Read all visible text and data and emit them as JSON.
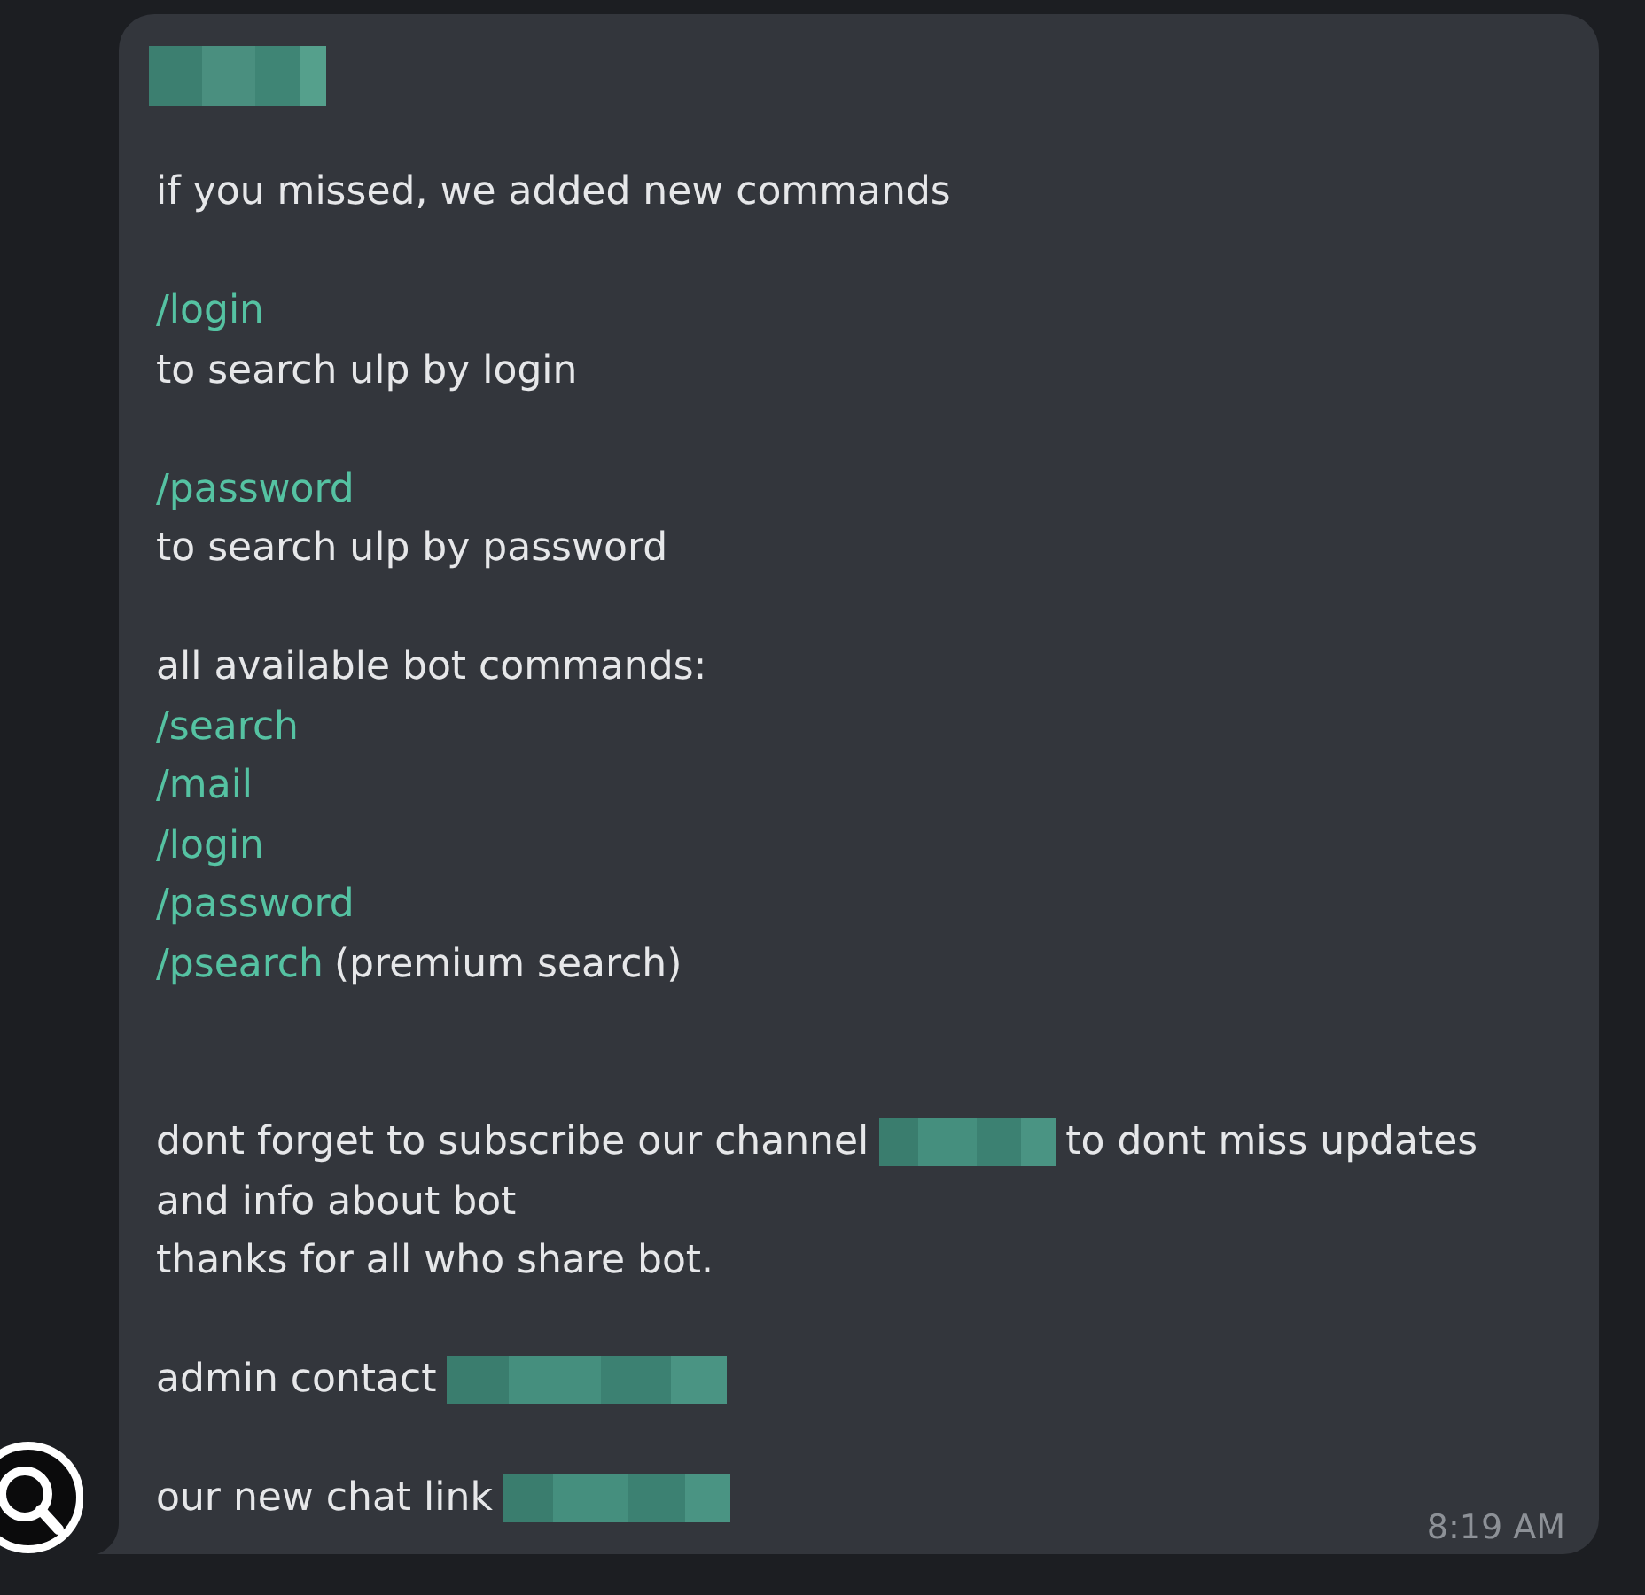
{
  "message": {
    "sender": {
      "kind": "redacted"
    },
    "lines": [
      {
        "kind": "line",
        "segments": [
          {
            "kind": "text",
            "text": "if you missed, we added new commands"
          }
        ]
      },
      {
        "kind": "blank"
      },
      {
        "kind": "line",
        "segments": [
          {
            "kind": "command",
            "text": "/login"
          }
        ]
      },
      {
        "kind": "line",
        "segments": [
          {
            "kind": "text",
            "text": "to search ulp by login"
          }
        ]
      },
      {
        "kind": "blank"
      },
      {
        "kind": "line",
        "segments": [
          {
            "kind": "command",
            "text": "/password"
          }
        ]
      },
      {
        "kind": "line",
        "segments": [
          {
            "kind": "text",
            "text": "to search ulp by password"
          }
        ]
      },
      {
        "kind": "blank"
      },
      {
        "kind": "line",
        "segments": [
          {
            "kind": "text",
            "text": "all available bot commands:"
          }
        ]
      },
      {
        "kind": "line",
        "segments": [
          {
            "kind": "command",
            "text": "/search"
          }
        ]
      },
      {
        "kind": "line",
        "segments": [
          {
            "kind": "command",
            "text": "/mail"
          }
        ]
      },
      {
        "kind": "line",
        "segments": [
          {
            "kind": "command",
            "text": "/login"
          }
        ]
      },
      {
        "kind": "line",
        "segments": [
          {
            "kind": "command",
            "text": "/password"
          }
        ]
      },
      {
        "kind": "line",
        "segments": [
          {
            "kind": "command",
            "text": "/psearch"
          },
          {
            "kind": "text",
            "text": "(premium search)"
          }
        ]
      },
      {
        "kind": "blank"
      },
      {
        "kind": "blank"
      },
      {
        "kind": "line",
        "segments": [
          {
            "kind": "text",
            "text": "dont forget to subscribe our channel"
          },
          {
            "kind": "redacted"
          },
          {
            "kind": "text",
            "text": "to dont miss updates"
          }
        ]
      },
      {
        "kind": "line",
        "segments": [
          {
            "kind": "text",
            "text": "and info about bot"
          }
        ]
      },
      {
        "kind": "line",
        "segments": [
          {
            "kind": "text",
            "text": "thanks for all who share bot."
          }
        ]
      },
      {
        "kind": "blank"
      },
      {
        "kind": "line",
        "segments": [
          {
            "kind": "text",
            "text": "admin contact"
          },
          {
            "kind": "redacted"
          }
        ]
      },
      {
        "kind": "blank"
      },
      {
        "kind": "line",
        "segments": [
          {
            "kind": "text",
            "text": "our new chat link"
          },
          {
            "kind": "redacted"
          }
        ]
      }
    ],
    "time": "8:19 AM"
  }
}
